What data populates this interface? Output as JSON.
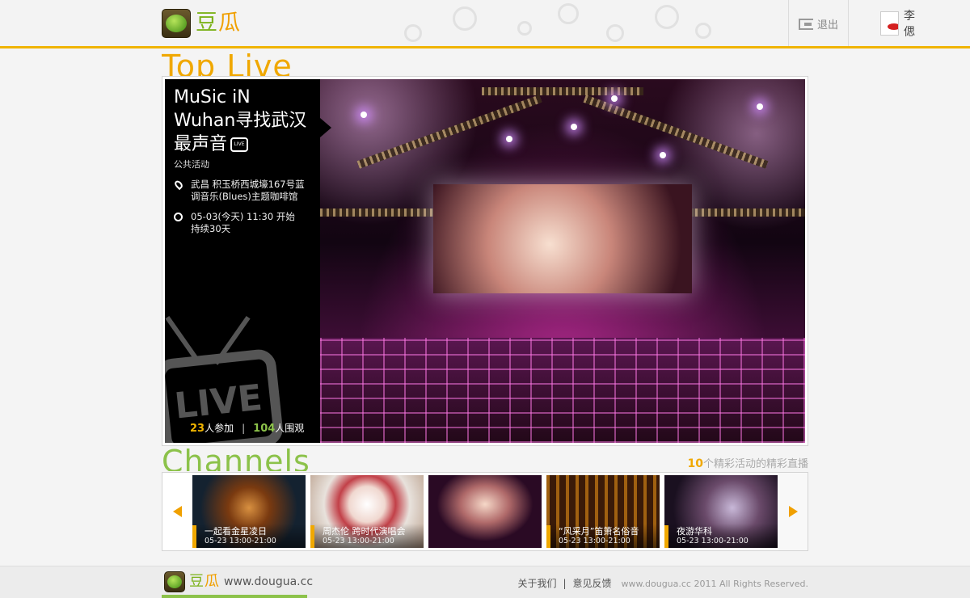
{
  "header": {
    "logo_text_a": "豆",
    "logo_text_b": "瓜",
    "user_name": "李偲",
    "logout_label": "退出"
  },
  "top_live": {
    "section_title": "Top Live",
    "title": "MuSic iN Wuhan寻找武汉最声音",
    "live_badge": "LIVE",
    "type": "公共活动",
    "location": "武昌 积玉桥西城壕167号蓝调音乐(Blues)主题咖啡馆",
    "time_line1": "05-03(今天) 11:30 开始",
    "time_line2": "持续30天",
    "tv_text": "LIVE",
    "participants": "23",
    "participants_label": "人参加",
    "viewers": "104",
    "viewers_label": "人围观"
  },
  "channels": {
    "section_title": "Channels",
    "count": "10",
    "count_label": "个精彩活动的精彩直播",
    "items": [
      {
        "title": "一起看金星凌日",
        "time": "05-23  13:00-21:00"
      },
      {
        "title": "周杰伦 跨时代演唱会",
        "time": "05-23  13:00-21:00"
      },
      {
        "title": "",
        "time": ""
      },
      {
        "title": "“风采月”笛箫名俗音",
        "time": "05-23  13:00-21:00"
      },
      {
        "title": "夜游华科",
        "time": "05-23  13:00-21:00"
      }
    ]
  },
  "footer": {
    "logo_text_a": "豆",
    "logo_text_b": "瓜",
    "url": "www.dougua.cc",
    "about": "关于我们",
    "feedback": "意见反馈",
    "copyright": "www.dougua.cc 2011 All Rights Reserved."
  },
  "colors": {
    "accent": "#f0b400",
    "green": "#8cc24a"
  }
}
